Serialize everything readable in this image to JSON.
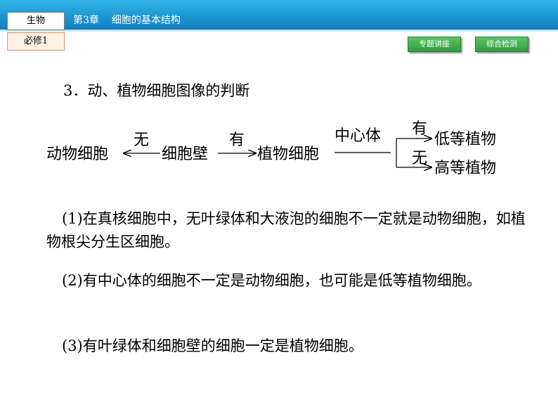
{
  "header": {
    "subject": "生物",
    "book": "必修1",
    "chapter_no": "第3章",
    "chapter_title": "细胞的基本结构",
    "nav": {
      "topic_lecture": "专题讲座",
      "comprehensive_test": "综合检测"
    }
  },
  "heading": "3．动、植物细胞图像的判断",
  "diagram": {
    "animal_cell": "动物细胞",
    "no_label": "无",
    "cell_wall": "细胞壁",
    "yes_label": "有",
    "plant_cell": "植物细胞",
    "centrosome": "中心体",
    "branch_yes": "有",
    "branch_no": "无",
    "lower_plant": "低等植物",
    "higher_plant": "高等植物"
  },
  "paragraphs": {
    "p1": "(1)在真核细胞中，无叶绿体和大液泡的细胞不一定就是动物细胞，如植物根尖分生区细胞。",
    "p2": "(2)有中心体的细胞不一定是动物细胞，也可能是低等植物细胞。",
    "p3": "(3)有叶绿体和细胞壁的细胞一定是植物细胞。"
  }
}
